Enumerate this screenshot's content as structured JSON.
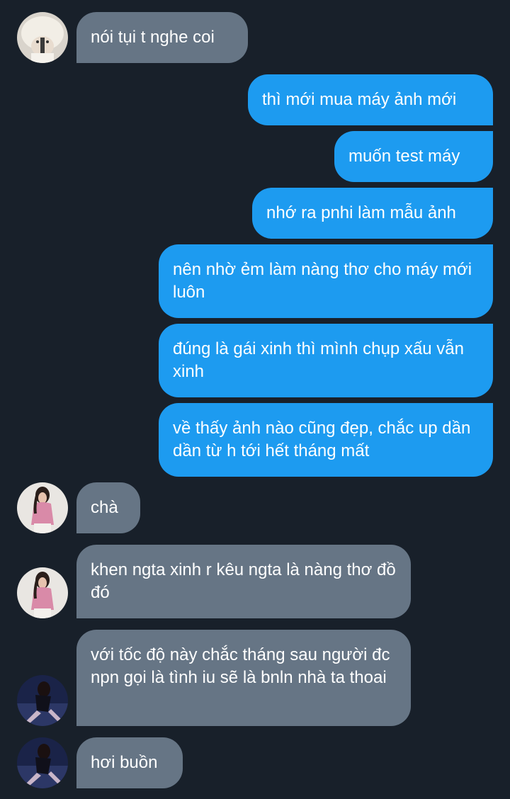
{
  "messages": [
    {
      "id": "m1",
      "side": "in",
      "text": "nói tụi t nghe coi"
    },
    {
      "id": "m2",
      "side": "out",
      "text": "thì mới mua máy ảnh mới"
    },
    {
      "id": "m3",
      "side": "out",
      "text": "muốn test máy"
    },
    {
      "id": "m4",
      "side": "out",
      "text": "nhớ ra pnhi làm mẫu ảnh"
    },
    {
      "id": "m5",
      "side": "out",
      "text": "nên nhờ ẻm làm nàng thơ cho máy mới luôn"
    },
    {
      "id": "m6",
      "side": "out",
      "text": "đúng là gái xinh thì mình chụp xấu vẫn xinh"
    },
    {
      "id": "m7",
      "side": "out",
      "text": "về thấy ảnh nào cũng đẹp, chắc up dần dần từ h tới hết tháng mất"
    },
    {
      "id": "m8",
      "side": "in",
      "text": "chà"
    },
    {
      "id": "m9",
      "side": "in",
      "text": "khen ngta xinh r kêu ngta là nàng thơ đồ đó"
    },
    {
      "id": "m10",
      "side": "in",
      "text": "với tốc độ này chắc tháng sau người đc npn gọi là tình iu sẽ là bnln nhà ta thoai"
    },
    {
      "id": "m11",
      "side": "in",
      "text": "hơi buồn"
    }
  ],
  "avatars": {
    "user_a": "avatar-white-hat",
    "user_b": "avatar-pink-top",
    "user_c": "avatar-dark-photo"
  },
  "colors": {
    "background": "#18202a",
    "incoming_bubble": "#667585",
    "outgoing_bubble": "#1d9bf0",
    "text": "#ffffff"
  }
}
